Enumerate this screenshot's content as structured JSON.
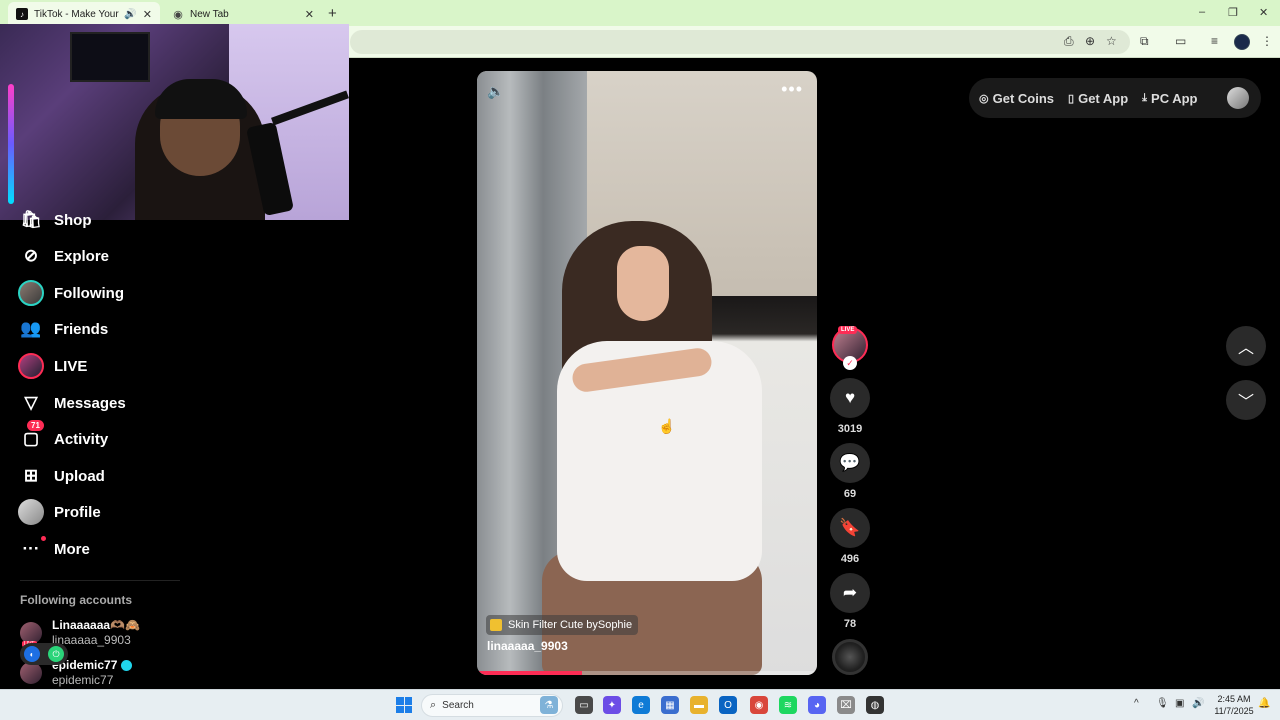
{
  "browser": {
    "tabs": [
      {
        "title": "TikTok - Make Your Day",
        "active": true
      },
      {
        "title": "New Tab",
        "active": false
      }
    ],
    "new_tab_symbol": "+",
    "window_controls": [
      "–",
      "❐",
      "✕"
    ]
  },
  "sidebar": {
    "items": [
      {
        "label": "Shop",
        "icon": "shop-icon"
      },
      {
        "label": "Explore",
        "icon": "compass-icon"
      },
      {
        "label": "Following",
        "icon": "following-avatar"
      },
      {
        "label": "Friends",
        "icon": "friends-icon"
      },
      {
        "label": "LIVE",
        "icon": "live-avatar"
      },
      {
        "label": "Messages",
        "icon": "paper-plane-icon"
      },
      {
        "label": "Activity",
        "icon": "inbox-icon",
        "badge": "71"
      },
      {
        "label": "Upload",
        "icon": "plus-square-icon"
      },
      {
        "label": "Profile",
        "icon": "profile-avatar"
      },
      {
        "label": "More",
        "icon": "more-dots-icon"
      }
    ],
    "following_title": "Following accounts",
    "accounts": [
      {
        "name": "Linaaaaaa🫶🏽🙈",
        "username": "linaaaaa_9903",
        "live": "LIVE"
      },
      {
        "name": "epidemic77",
        "username": "epidemic77",
        "verified": true
      }
    ]
  },
  "header": {
    "get_coins": "Get Coins",
    "get_app": "Get App",
    "pc_app": "PC App"
  },
  "video": {
    "effect": "Skin Filter Cute bySophie",
    "author": "linaaaaa_9903",
    "progress": 0.31,
    "menu": "•••"
  },
  "actions": {
    "live_badge": "LIVE",
    "likes": "3019",
    "comments": "69",
    "saves": "496",
    "shares": "78"
  },
  "taskbar": {
    "search_placeholder": "Search",
    "time": "2:45 AM",
    "date": "11/7/2025"
  },
  "colors": {
    "accent": "#fe2c55",
    "background": "#000000",
    "tab_bar": "#d9f5c9"
  }
}
